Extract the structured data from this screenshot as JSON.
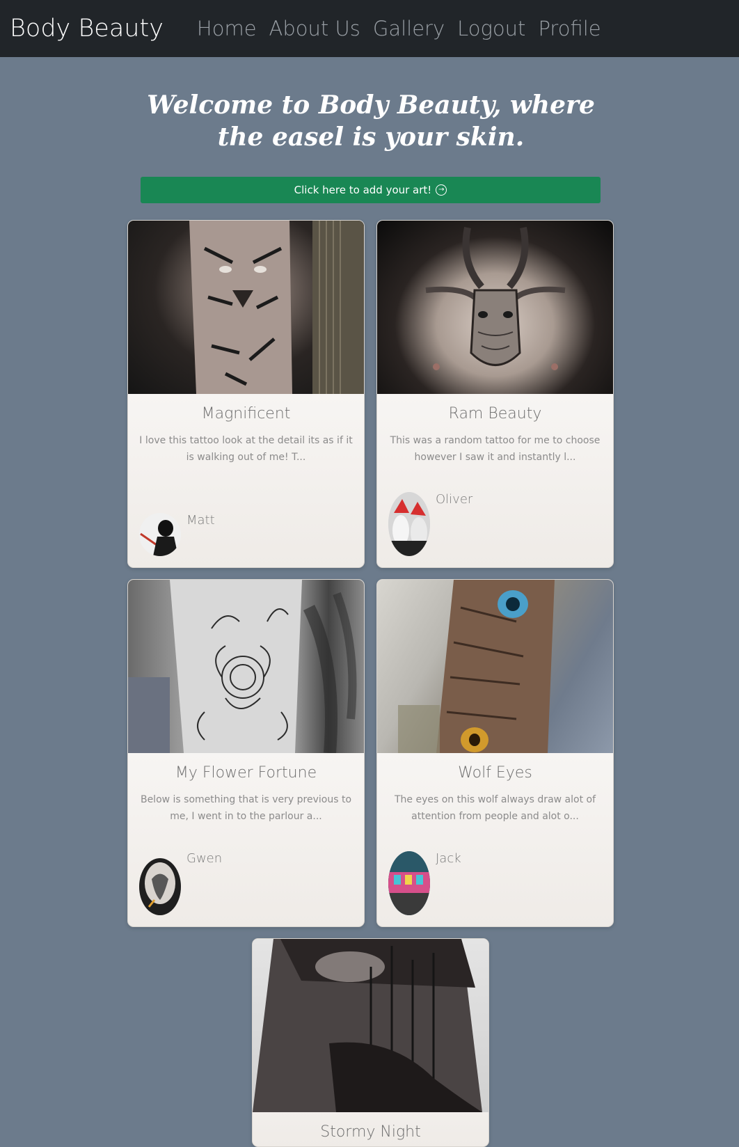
{
  "nav": {
    "brand": "Body Beauty",
    "links": [
      "Home",
      "About Us",
      "Gallery",
      "Logout",
      "Profile"
    ]
  },
  "hero": {
    "heading": "Welcome to Body Beauty, where the easel is your skin."
  },
  "add_button": {
    "label": "Click here to add your art!",
    "icon": "arrow-right-circle-icon"
  },
  "cards": [
    {
      "title": "Magnificent",
      "text": "I love this tattoo look at the detail its as if it is walking out of me! T...",
      "author": "Matt"
    },
    {
      "title": "Ram Beauty",
      "text": "This was a random tattoo for me to choose however I saw it and instantly l...",
      "author": "Oliver"
    },
    {
      "title": "My Flower Fortune",
      "text": "Below is something that is very previous to me, I went in to the parlour a...",
      "author": "Gwen"
    },
    {
      "title": "Wolf Eyes",
      "text": "The eyes on this wolf always draw alot of attention from people and alot o...",
      "author": "Jack"
    },
    {
      "title": "Stormy Night",
      "text": "",
      "author": ""
    }
  ],
  "colors": {
    "navbar_bg": "#212529",
    "page_bg": "#6c7b8c",
    "button_bg": "#198754"
  }
}
